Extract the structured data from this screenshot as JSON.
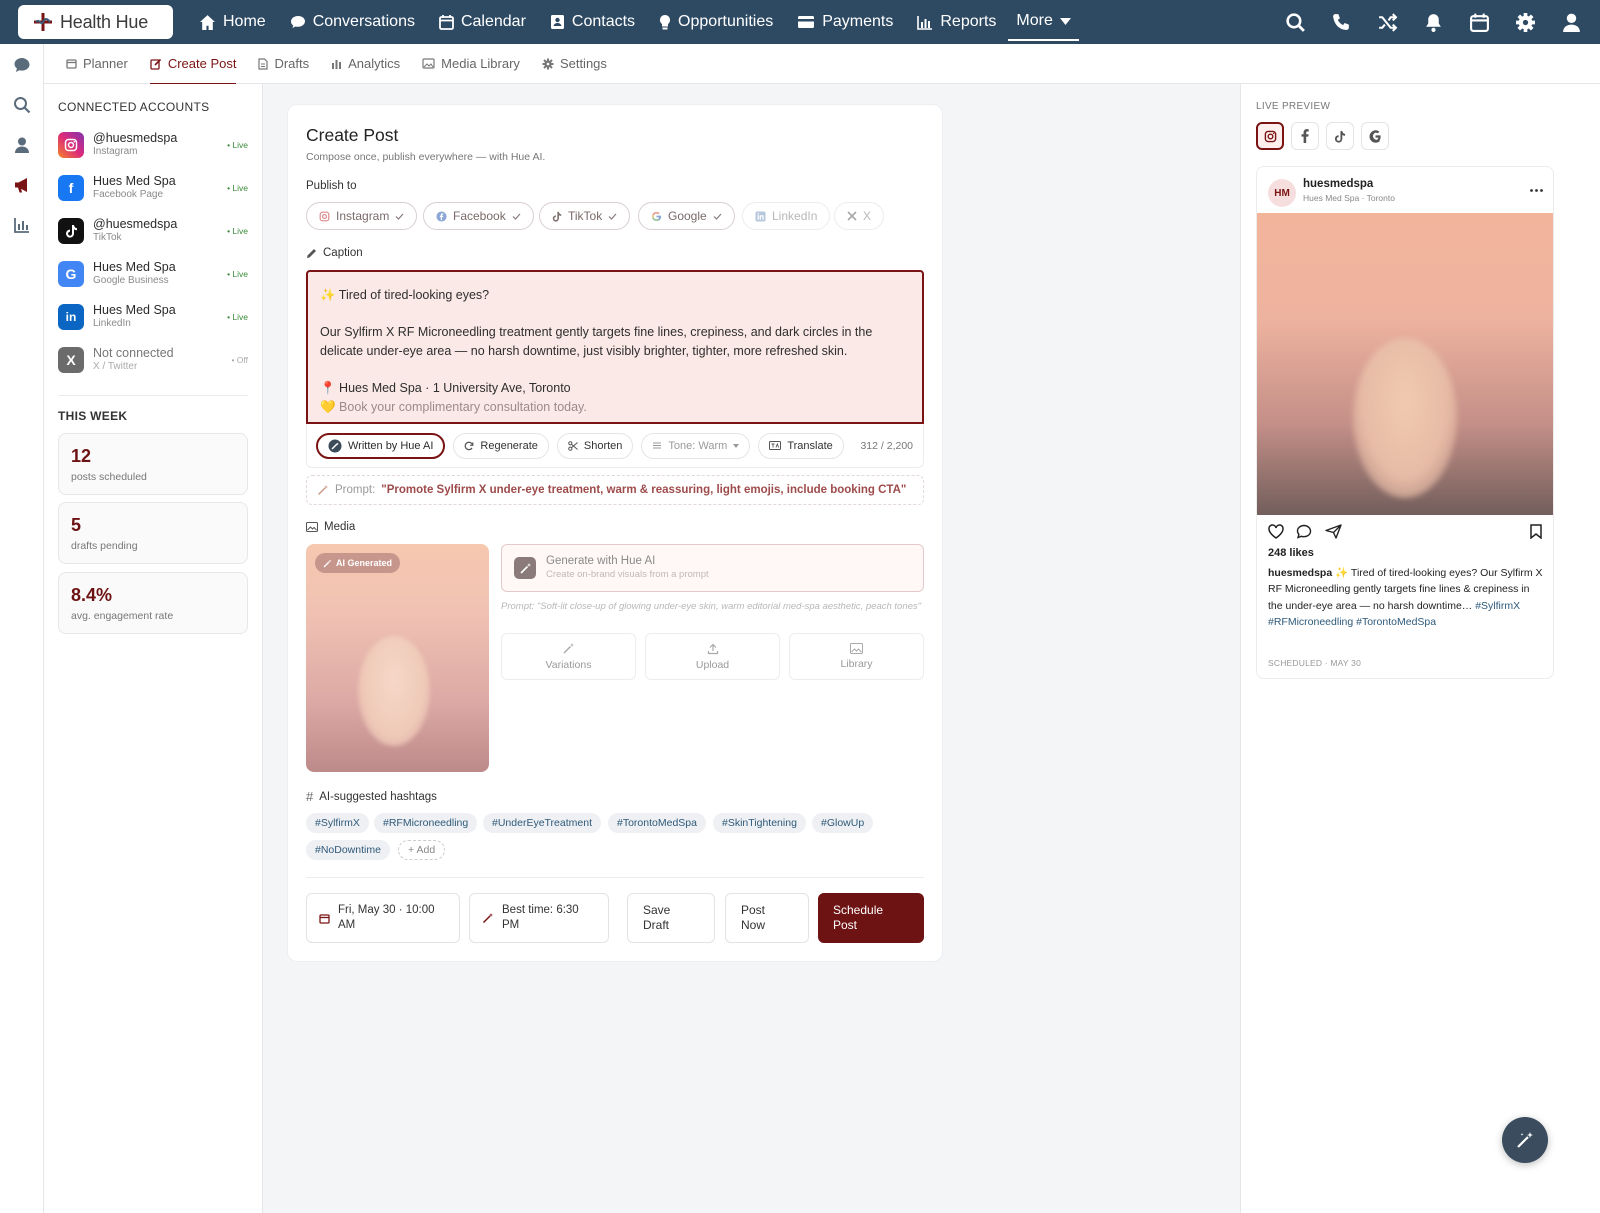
{
  "topnav": {
    "brand": "Health Hue",
    "items": [
      {
        "label": "Home",
        "icon": "home-icon"
      },
      {
        "label": "Conversations",
        "icon": "chat-icon"
      },
      {
        "label": "Calendar",
        "icon": "calendar-icon"
      },
      {
        "label": "Contacts",
        "icon": "contacts-icon"
      },
      {
        "label": "Opportunities",
        "icon": "lightbulb-icon"
      },
      {
        "label": "Payments",
        "icon": "credit-card-icon"
      },
      {
        "label": "Reports",
        "icon": "bar-chart-icon"
      }
    ],
    "more_label": "More",
    "right_icons": [
      "search-icon",
      "phone-icon",
      "shuffle-icon",
      "bell-icon",
      "calendar-icon",
      "gear-icon",
      "user-icon"
    ]
  },
  "rail_icons": [
    "chat-icon",
    "search-icon",
    "user-icon",
    "megaphone-icon",
    "bar-chart-icon"
  ],
  "subnav": {
    "items": [
      {
        "label": "Planner",
        "icon": "calendar-icon"
      },
      {
        "label": "Create Post",
        "icon": "edit-icon"
      },
      {
        "label": "Drafts",
        "icon": "document-icon"
      },
      {
        "label": "Analytics",
        "icon": "bar-chart-icon"
      },
      {
        "label": "Media Library",
        "icon": "image-icon"
      },
      {
        "label": "Settings",
        "icon": "gear-icon"
      }
    ],
    "active": "Create Post"
  },
  "accounts": {
    "title": "Connected Accounts",
    "items": [
      {
        "name": "@huesmedspa",
        "type": "Instagram",
        "status": "• Live",
        "color": "#e1306c"
      },
      {
        "name": "Hues Med Spa",
        "type": "Facebook Page",
        "status": "• Live",
        "color": "#1877f2"
      },
      {
        "name": "@huesmedspa",
        "type": "TikTok",
        "status": "• Live",
        "color": "#111111"
      },
      {
        "name": "Hues Med Spa",
        "type": "Google Business",
        "status": "• Live",
        "color": "#4285f4"
      },
      {
        "name": "Hues Med Spa",
        "type": "LinkedIn",
        "status": "• Live",
        "color": "#0a66c2"
      },
      {
        "name": "Not connected",
        "type": "X / Twitter",
        "status": "• Off",
        "color": "#6b6b6b"
      }
    ]
  },
  "week": {
    "title": "This Week",
    "stats": [
      {
        "value": "12",
        "label": "posts scheduled"
      },
      {
        "value": "5",
        "label": "drafts pending"
      },
      {
        "value": "8.4%",
        "label": "avg. engagement rate"
      }
    ]
  },
  "create": {
    "title": "Create Post",
    "subtitle": "Compose once, publish everywhere — with Hue AI.",
    "publish_label": "Publish to",
    "platforms": [
      {
        "label": "Instagram",
        "selected": true
      },
      {
        "label": "Facebook",
        "selected": true
      },
      {
        "label": "TikTok",
        "selected": true
      },
      {
        "label": "Google",
        "selected": true
      },
      {
        "label": "LinkedIn",
        "selected": false
      },
      {
        "label": "X",
        "selected": false
      }
    ],
    "caption_label": "Caption",
    "caption": {
      "line1": "✨ Tired of tired-looking eyes?",
      "line2": "Our Sylfirm X RF Microneedling treatment gently targets fine lines, crepiness, and dark circles in the",
      "line3": "delicate under-eye area — no harsh downtime, just visibly brighter, tighter, more refreshed skin.",
      "line4": "📍 Hues Med Spa · 1 University Ave, Toronto",
      "line5": "💛 Book your complimentary consultation today."
    },
    "toolbar": {
      "written": "Written by Hue AI",
      "regenerate": "Regenerate",
      "shorten": "Shorten",
      "tone": "Tone: Warm",
      "translate": "Translate",
      "count": "312 / 2,200"
    },
    "prompt_label": "Prompt:",
    "prompt_text": "\"Promote Sylfirm X under-eye treatment, warm & reassuring, light emojis, include booking CTA\"",
    "media_label": "Media",
    "ai_tag": "AI Generated",
    "generate_title": "Generate with Hue AI",
    "generate_sub": "Create on-brand visuals from a prompt",
    "generate_prompt": "Prompt: \"Soft-lit close-up of glowing under-eye skin, warm editorial med-spa aesthetic, peach tones\"",
    "media_actions": [
      "Variations",
      "Upload",
      "Library"
    ],
    "hashtags_label": "AI-suggested hashtags",
    "hashtags": [
      "#SylfirmX",
      "#RFMicroneedling",
      "#UnderEyeTreatment",
      "#TorontoMedSpa",
      "#SkinTightening",
      "#GlowUp",
      "#NoDowntime"
    ],
    "add_tag": "+ Add",
    "schedule": {
      "date_line1": "Fri, May 30 · 10:00",
      "date_line2": "AM",
      "best_line1": "Best time: 6:30",
      "best_line2": "PM",
      "save_line1": "Save",
      "save_line2": "Draft",
      "post_line1": "Post",
      "post_line2": "Now",
      "schedule_line1": "Schedule",
      "schedule_line2": "Post"
    }
  },
  "preview": {
    "title": "Live Preview",
    "tabs": [
      "instagram-icon",
      "facebook-icon",
      "tiktok-icon",
      "google-icon"
    ],
    "avatar": "HM",
    "username": "huesmedspa",
    "location": "Hues Med Spa · Toronto",
    "likes": "248 likes",
    "caption_user": "huesmedspa",
    "caption_text": "✨ Tired of tired-looking eyes? Our Sylfirm X RF Microneedling gently targets fine lines & crepiness in the under-eye area — no harsh downtime…",
    "caption_tags": "#SylfirmX #RFMicroneedling #TorontoMedSpa",
    "scheduled": "SCHEDULED · MAY 30"
  },
  "colors": {
    "nav": "#2e4a63",
    "accent": "#7a1414",
    "primary_button": "#6e1313"
  }
}
